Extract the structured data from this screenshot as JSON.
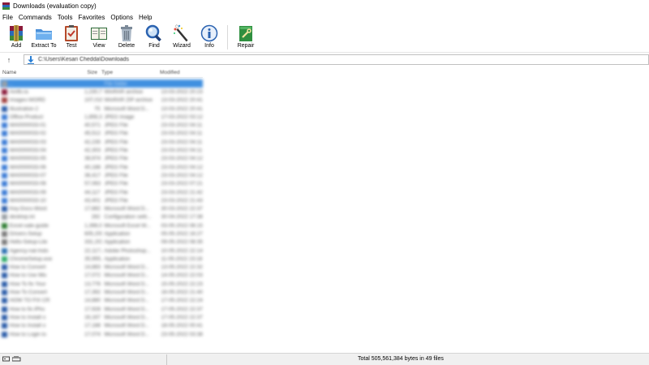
{
  "window": {
    "title": "Downloads (evaluation copy)"
  },
  "menu": [
    "File",
    "Commands",
    "Tools",
    "Favorites",
    "Options",
    "Help"
  ],
  "toolbar": {
    "buttons": [
      {
        "label": "Add",
        "icon": "archive-add-icon"
      },
      {
        "label": "Extract To",
        "icon": "folder-extract-icon"
      },
      {
        "label": "Test",
        "icon": "clipboard-test-icon"
      },
      {
        "label": "View",
        "icon": "book-view-icon"
      },
      {
        "label": "Delete",
        "icon": "trash-icon"
      },
      {
        "label": "Find",
        "icon": "magnifier-icon"
      },
      {
        "label": "Wizard",
        "icon": "magic-wand-icon"
      },
      {
        "label": "Info",
        "icon": "info-icon"
      },
      {
        "label": "Repair",
        "icon": "repair-icon"
      }
    ]
  },
  "address": {
    "path": "C:\\Users\\Kesari Chedda\\Downloads",
    "up_glyph": "↑"
  },
  "list": {
    "columns": [
      "Name",
      "Size",
      "Type",
      "Modified"
    ],
    "rows": [
      {
        "name": "..",
        "size": "",
        "type": "File folder",
        "mod": "",
        "color": "#9aa0a6",
        "selected": true
      },
      {
        "name": "Amfb.ra",
        "size": "1,230,771",
        "type": "WinRAR archive",
        "mod": "13-03-2022 20:23",
        "color": "#8b1a3a"
      },
      {
        "name": "Images-WORD",
        "size": "107,016,211",
        "type": "WinRAR ZIP archive",
        "mod": "13-03-2022 20:41",
        "color": "#a04040"
      },
      {
        "name": "Illustration-2",
        "size": "75",
        "type": "Microsoft Word D...",
        "mod": "13-03-2022 20:41",
        "color": "#2b5ca8"
      },
      {
        "name": "Office-Product",
        "size": "1,856,315",
        "type": "JPEG Image",
        "mod": "17-03-2022 03:12",
        "color": "#3a7bd5"
      },
      {
        "name": "WA0000033-01",
        "size": "40,571",
        "type": "JPEG File",
        "mod": "23-03-2022 04:11",
        "color": "#3a7bd5"
      },
      {
        "name": "WA0000033-02",
        "size": "45,512",
        "type": "JPEG File",
        "mod": "23-03-2022 04:11",
        "color": "#3a7bd5"
      },
      {
        "name": "WA0000033-03",
        "size": "42,235",
        "type": "JPEG File",
        "mod": "23-03-2022 04:11",
        "color": "#3a7bd5"
      },
      {
        "name": "WA0000033-04",
        "size": "42,303",
        "type": "JPEG File",
        "mod": "23-03-2022 04:11",
        "color": "#3a7bd5"
      },
      {
        "name": "WA0000033-05",
        "size": "38,974",
        "type": "JPEG File",
        "mod": "23-03-2022 04:12",
        "color": "#3a7bd5"
      },
      {
        "name": "WA0000033-06",
        "size": "40,188",
        "type": "JPEG File",
        "mod": "23-03-2022 04:12",
        "color": "#3a7bd5"
      },
      {
        "name": "WA0000033-07",
        "size": "36,417",
        "type": "JPEG File",
        "mod": "23-03-2022 04:12",
        "color": "#3a7bd5"
      },
      {
        "name": "WA0000033-08",
        "size": "57,063",
        "type": "JPEG File",
        "mod": "23-03-2022 07:21",
        "color": "#3a7bd5"
      },
      {
        "name": "WA0000033-09",
        "size": "44,117",
        "type": "JPEG File",
        "mod": "23-03-2022 21:42",
        "color": "#3a7bd5"
      },
      {
        "name": "WA0000033-10",
        "size": "43,401",
        "type": "JPEG File",
        "mod": "23-03-2022 21:43",
        "color": "#3a7bd5"
      },
      {
        "name": "Key-Docs-Word",
        "size": "17,882",
        "type": "Microsoft Word D...",
        "mod": "30-03-2022 22:37",
        "color": "#2b5ca8"
      },
      {
        "name": "desktop.ini",
        "size": "282",
        "type": "Configuration setti...",
        "mod": "30-04-2022 17:38",
        "color": "#9aa0a6"
      },
      {
        "name": "Excel-sale-guide",
        "size": "1,398,011",
        "type": "Microsoft Excel W...",
        "mod": "03-05-2022 08:15",
        "color": "#2e7d32"
      },
      {
        "name": "Drivers-Setup",
        "size": "605,200",
        "type": "Application",
        "mod": "05-05-2022 16:27",
        "color": "#7a7a7a"
      },
      {
        "name": "Hello-Setup-Lite",
        "size": "331,203",
        "type": "Application",
        "mod": "09-05-2022 08:35",
        "color": "#7a7a7a"
      },
      {
        "name": "Agency-nat-Indo",
        "size": "22,117,831",
        "type": "Adobe Photoshop...",
        "mod": "10-05-2022 22:14",
        "color": "#2a6fb0"
      },
      {
        "name": "ChromeSetup.exe",
        "size": "35,955,209",
        "type": "Application",
        "mod": "11-05-2022 23:18",
        "color": "#2eaa6a"
      },
      {
        "name": "How to Convert",
        "size": "14,883",
        "type": "Microsoft Word D...",
        "mod": "13-05-2022 22:32",
        "color": "#2b5ca8"
      },
      {
        "name": "How to Use Mis",
        "size": "17,072",
        "type": "Microsoft Word D...",
        "mod": "14-05-2022 22:03",
        "color": "#2b5ca8"
      },
      {
        "name": "How To fix Your",
        "size": "13,776",
        "type": "Microsoft Word D...",
        "mod": "15-05-2022 22:23",
        "color": "#2b5ca8"
      },
      {
        "name": "How To Convert",
        "size": "17,392",
        "type": "Microsoft Word D...",
        "mod": "16-05-2022 21:40",
        "color": "#2b5ca8"
      },
      {
        "name": "HOW TO FIX CR",
        "size": "14,880",
        "type": "Microsoft Word D...",
        "mod": "17-05-2022 22:24",
        "color": "#2b5ca8"
      },
      {
        "name": "How to fix iPho",
        "size": "17,928",
        "type": "Microsoft Word D...",
        "mod": "17-05-2022 22:37",
        "color": "#2b5ca8"
      },
      {
        "name": "How to Install o",
        "size": "16,167",
        "type": "Microsoft Word D...",
        "mod": "17-05-2022 22:37",
        "color": "#2b5ca8"
      },
      {
        "name": "How to Install o",
        "size": "17,188",
        "type": "Microsoft Word D...",
        "mod": "18-05-2022 00:41",
        "color": "#2b5ca8"
      },
      {
        "name": "How to Login to",
        "size": "17,074",
        "type": "Microsoft Word D...",
        "mod": "23-05-2022 03:38",
        "color": "#2b5ca8"
      }
    ]
  },
  "status": {
    "total": "Total 505,561,384 bytes in 49 files"
  }
}
